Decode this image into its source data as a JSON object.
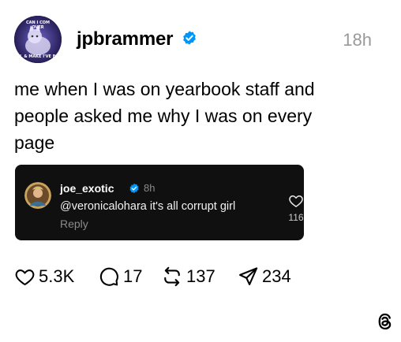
{
  "post": {
    "username": "jpbrammer",
    "timestamp": "18h",
    "avatar_text_top_1": "CAN I COM",
    "avatar_text_top_2": "OVER",
    "avatar_text_bottom": "LL & MAKE I'VE BE",
    "text_lines": [
      "me when I was on yearbook staff and",
      "people asked me why I was on every",
      "page"
    ]
  },
  "embedded_reply": {
    "username": "joe_exotic",
    "timestamp": "8h",
    "mention": "@veronicalohara",
    "comment": " it's all corrupt girl",
    "reply_label": "Reply",
    "like_count": "116"
  },
  "actions": {
    "likes": "5.3K",
    "comments": "17",
    "reposts": "137",
    "shares": "234"
  },
  "icons": {
    "verified": "verified-badge-icon",
    "heart": "heart-icon",
    "comment": "comment-icon",
    "repost": "repost-icon",
    "share": "share-icon",
    "logo": "threads-logo-icon"
  },
  "colors": {
    "verified_blue": "#0095f6",
    "embed_bg": "#101010",
    "muted": "#999999"
  }
}
